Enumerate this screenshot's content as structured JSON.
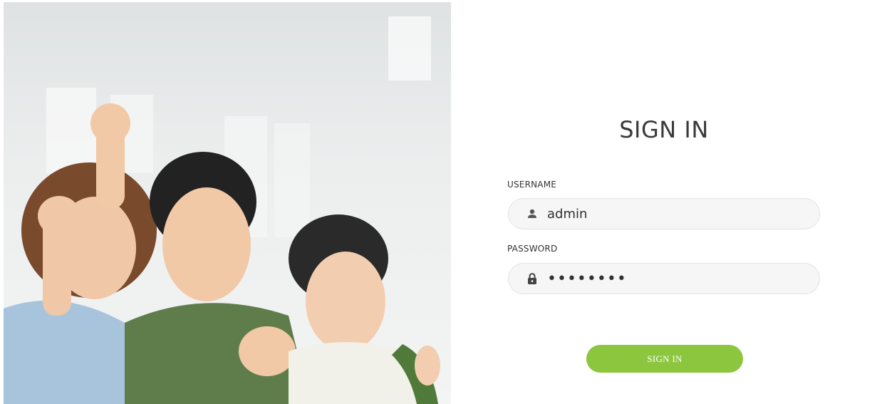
{
  "hero": {
    "image": "family-celebrating-photo"
  },
  "form": {
    "title": "SIGN IN",
    "username": {
      "label": "USERNAME",
      "value": "admin",
      "icon": "user-icon"
    },
    "password": {
      "label": "PASSWORD",
      "value": "••••••••",
      "icon": "lock-icon"
    },
    "submit_label": "SIGN IN",
    "accent_color": "#8cc63e"
  }
}
